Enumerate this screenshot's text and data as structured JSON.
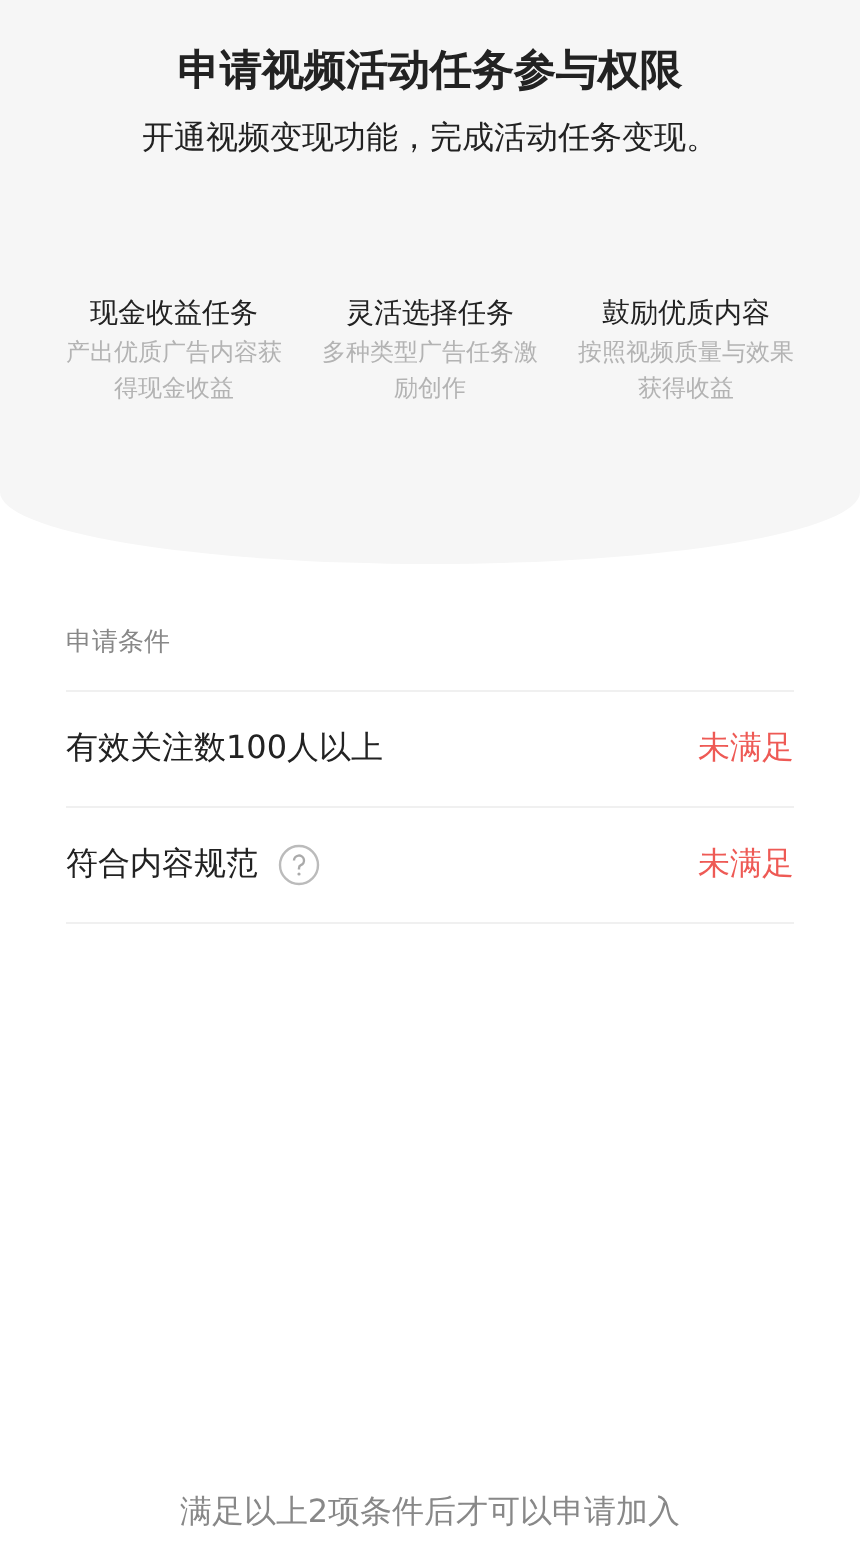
{
  "header": {
    "title": "申请视频活动任务参与权限",
    "subtitle": "开通视频变现功能，完成活动任务变现。"
  },
  "features": [
    {
      "title": "现金收益任务",
      "description": "产出优质广告内容获得现金收益"
    },
    {
      "title": "灵活选择任务",
      "description": "多种类型广告任务激励创作"
    },
    {
      "title": "鼓励优质内容",
      "description": "按照视频质量与效果获得收益"
    }
  ],
  "conditions": {
    "label": "申请条件",
    "items": [
      {
        "text": "有效关注数100人以上",
        "help": false,
        "met": false,
        "status": "未满足"
      },
      {
        "text": "符合内容规范",
        "help": true,
        "met": false,
        "status": "未满足"
      }
    ]
  },
  "footer": "满足以上2项条件后才可以申请加入"
}
